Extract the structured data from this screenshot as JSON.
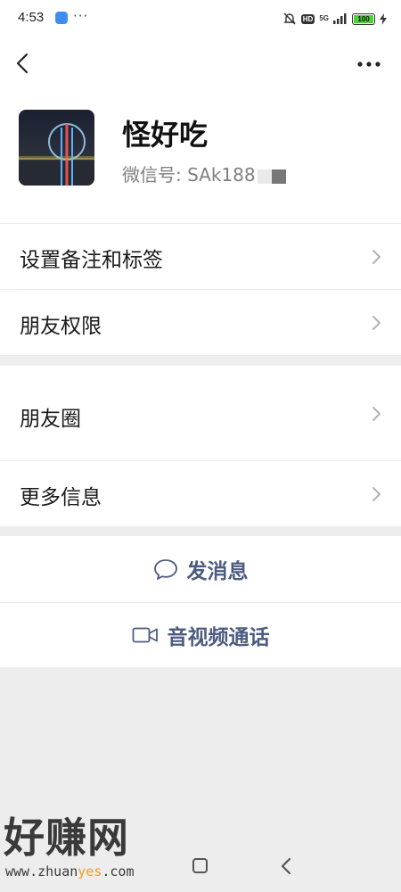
{
  "status_bar": {
    "time": "4:53",
    "more": "···",
    "hd": "HD",
    "network": "5G",
    "battery": "100"
  },
  "profile": {
    "name": "怪好吃",
    "wechat_id": "微信号: SAk188"
  },
  "menu": {
    "remark_tags": "设置备注和标签",
    "friend_permissions": "朋友权限",
    "moments": "朋友圈",
    "more_info": "更多信息"
  },
  "actions": {
    "send_message": "发消息",
    "video_call": "音视频通话"
  },
  "watermark": {
    "main": "好赚网",
    "url_prefix": "www.zhuan",
    "url_highlight": "yes",
    "url_suffix": ".com"
  },
  "colors": {
    "accent": "#4c5c80",
    "background": "#ededed",
    "battery": "#4cd137"
  }
}
